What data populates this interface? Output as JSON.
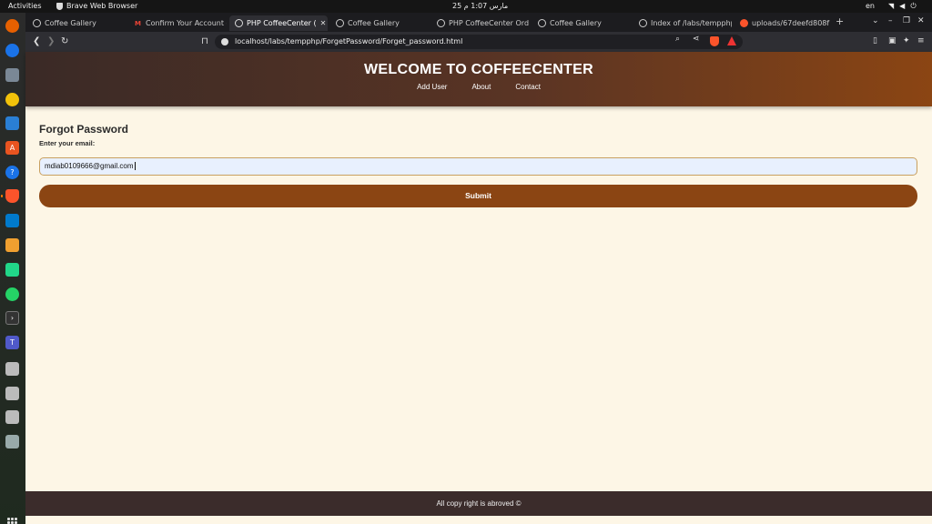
{
  "system": {
    "activities": "Activities",
    "app_name": "Brave Web Browser",
    "clock": "25 مارس  1:07 م",
    "lang": "en"
  },
  "tabs": [
    {
      "label": "Coffee Gallery",
      "favicon": "globe-icon",
      "active": false
    },
    {
      "label": "Confirm Your Account -",
      "favicon": "gmail-icon",
      "active": false
    },
    {
      "label": "PHP CoffeeCenter (",
      "favicon": "globe-icon",
      "active": true
    },
    {
      "label": "Coffee Gallery",
      "favicon": "globe-icon",
      "active": false
    },
    {
      "label": "PHP CoffeeCenter Ord",
      "favicon": "globe-icon",
      "active": false
    },
    {
      "label": "Coffee Gallery",
      "favicon": "globe-icon",
      "active": false
    },
    {
      "label": "Index of /labs/tempphp",
      "favicon": "globe-icon",
      "active": false
    },
    {
      "label": "uploads/67deefd808f",
      "favicon": "brave-icon",
      "active": false
    }
  ],
  "browser": {
    "url": "localhost/labs/tempphp/ForgetPassword/Forget_password.html"
  },
  "site": {
    "title": "WELCOME TO COFFEECENTER",
    "nav": [
      "Add User",
      "About",
      "Contact"
    ],
    "form_heading": "Forgot Password",
    "email_label": "Enter your email:",
    "email_value": "mdiab0109666@gmail.com",
    "submit_label": "Submit",
    "footer": "All copy right is abroved ©"
  },
  "colors": {
    "header_start": "#3a2a26",
    "header_end": "#8b4513",
    "page_bg": "#fdf6e6",
    "button": "#8b4513",
    "footer_bg": "#3b2c2b"
  }
}
